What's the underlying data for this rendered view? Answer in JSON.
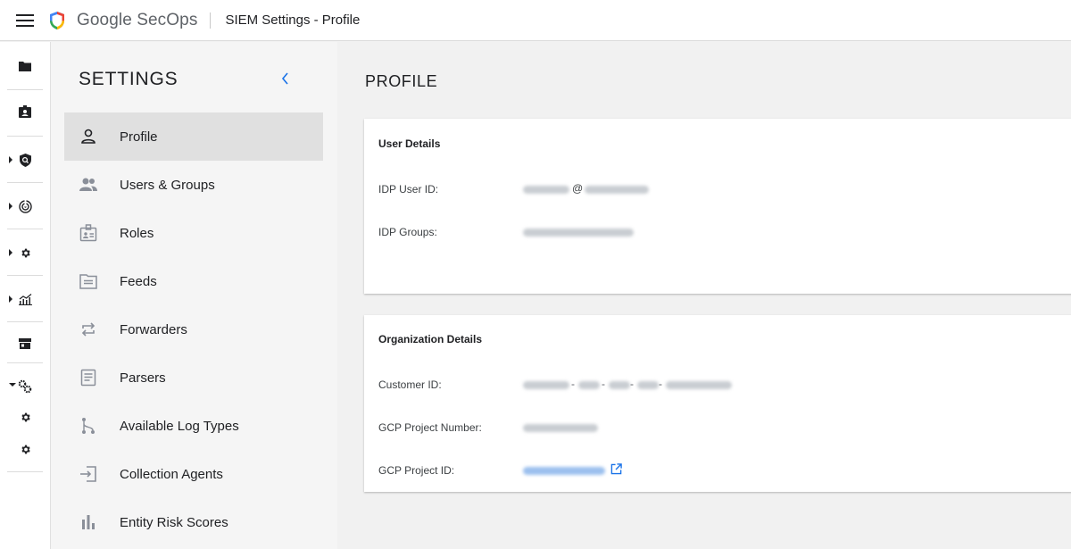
{
  "header": {
    "brand": "Google SecOps",
    "title": "SIEM Settings - Profile"
  },
  "rail": {
    "items": [
      {
        "icon": "folder-icon"
      },
      {
        "icon": "badge-icon"
      },
      {
        "icon": "shield-search-icon"
      },
      {
        "icon": "radar-icon"
      },
      {
        "icon": "gear-icon"
      },
      {
        "icon": "analytics-icon"
      },
      {
        "icon": "store-icon"
      },
      {
        "icon": "gears-icon"
      },
      {
        "icon": "gear-icon"
      },
      {
        "icon": "gear-icon"
      }
    ]
  },
  "settings": {
    "title": "SETTINGS",
    "items": [
      {
        "label": "Profile",
        "icon": "person-icon",
        "active": true
      },
      {
        "label": "Users & Groups",
        "icon": "people-icon"
      },
      {
        "label": "Roles",
        "icon": "id-badge-icon"
      },
      {
        "label": "Feeds",
        "icon": "folder-feed-icon"
      },
      {
        "label": "Forwarders",
        "icon": "forward-icon"
      },
      {
        "label": "Parsers",
        "icon": "document-icon"
      },
      {
        "label": "Available Log Types",
        "icon": "branch-icon"
      },
      {
        "label": "Collection Agents",
        "icon": "login-icon"
      },
      {
        "label": "Entity Risk Scores",
        "icon": "bar-chart-icon"
      }
    ]
  },
  "main": {
    "title": "PROFILE",
    "user_details": {
      "title": "User Details",
      "idp_user_id_label": "IDP User ID:",
      "idp_user_id_separator": "@",
      "idp_groups_label": "IDP Groups:"
    },
    "org_details": {
      "title": "Organization Details",
      "customer_id_label": "Customer ID:",
      "customer_id_separator": "-",
      "gcp_project_number_label": "GCP Project Number:",
      "gcp_project_id_label": "GCP Project ID:"
    }
  },
  "colors": {
    "accent": "#1a73e8",
    "nav_active_bg": "#e0e0e0",
    "icon_gray": "#8a8f99"
  }
}
